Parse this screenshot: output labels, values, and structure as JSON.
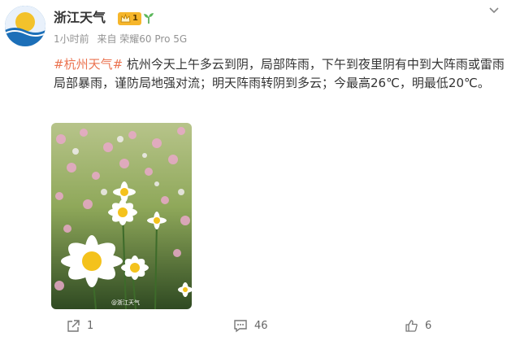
{
  "post": {
    "author": "浙江天气",
    "level": "1",
    "time": "1小时前",
    "source": "来自 荣耀60 Pro 5G",
    "topic": "#杭州天气#",
    "body": " 杭州今天上午多云到阴，局部阵雨，下午到夜里阴有中到大阵雨或雷雨局部暴雨，谨防局地强对流；明天阵雨转阴到多云；今最高26℃，明最低20℃。",
    "image_watermark": "@浙江天气"
  },
  "avatar": {
    "text": "浙江天气"
  },
  "actions": {
    "share_count": "1",
    "comment_count": "46",
    "like_count": "6"
  },
  "icons": {
    "more": "chevron-down-icon",
    "share": "share-icon",
    "comment": "comment-icon",
    "like": "thumbs-up-icon",
    "badge": "crown-icon",
    "sprout": "sprout-icon"
  },
  "colors": {
    "topic": "#eb7350",
    "meta": "#939393",
    "badge": "#f6b62b"
  }
}
